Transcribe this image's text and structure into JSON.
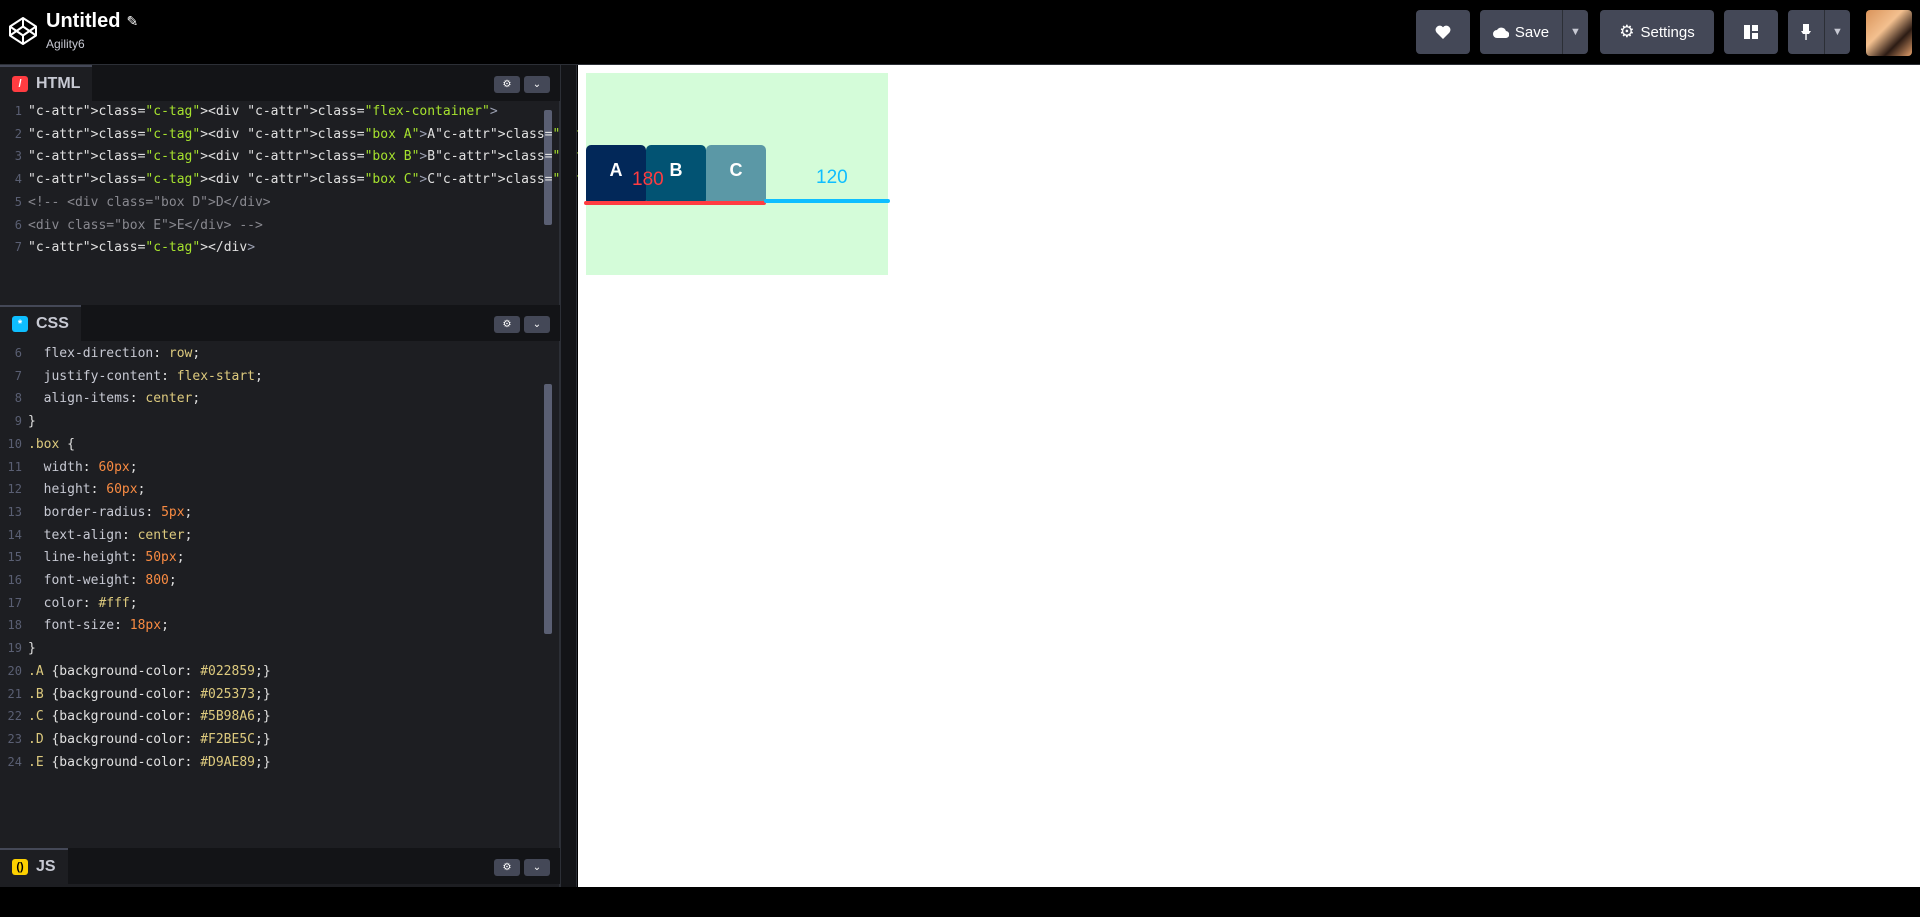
{
  "header": {
    "title": "Untitled",
    "subtitle": "Agility6",
    "save_label": "Save",
    "settings_label": "Settings"
  },
  "panels": {
    "html": {
      "label": "HTML",
      "icon": "/",
      "lines": [
        {
          "n": "1",
          "t": "<div class=\"flex-container\">"
        },
        {
          "n": "2",
          "t": "<div class=\"box A\">A</div>"
        },
        {
          "n": "3",
          "t": "<div class=\"box B\">B</div>"
        },
        {
          "n": "4",
          "t": "<div class=\"box C\">C</div>"
        },
        {
          "n": "5",
          "t": "<!-- <div class=\"box D\">D</div>"
        },
        {
          "n": "6",
          "t": "<div class=\"box E\">E</div> -->"
        },
        {
          "n": "7",
          "t": "</div>"
        }
      ]
    },
    "css": {
      "label": "CSS",
      "icon": "*",
      "lines": [
        {
          "n": "6",
          "t": "  flex-direction: row;"
        },
        {
          "n": "7",
          "t": "  justify-content: flex-start;"
        },
        {
          "n": "8",
          "t": "  align-items: center;"
        },
        {
          "n": "9",
          "t": "}"
        },
        {
          "n": "10",
          "t": ".box {"
        },
        {
          "n": "11",
          "t": "  width: 60px;"
        },
        {
          "n": "12",
          "t": "  height: 60px;"
        },
        {
          "n": "13",
          "t": "  border-radius: 5px;"
        },
        {
          "n": "14",
          "t": "  text-align: center;"
        },
        {
          "n": "15",
          "t": "  line-height: 50px;"
        },
        {
          "n": "16",
          "t": "  font-weight: 800;"
        },
        {
          "n": "17",
          "t": "  color: #fff;"
        },
        {
          "n": "18",
          "t": "  font-size: 18px;"
        },
        {
          "n": "19",
          "t": "}"
        },
        {
          "n": "20",
          "t": ".A {background-color: #022859;}"
        },
        {
          "n": "21",
          "t": ".B {background-color: #025373;}"
        },
        {
          "n": "22",
          "t": ".C {background-color: #5B98A6;}"
        },
        {
          "n": "23",
          "t": ".D {background-color: #F2BE5C;}"
        },
        {
          "n": "24",
          "t": ".E {background-color: #D9AE89;}"
        }
      ]
    },
    "js": {
      "label": "JS",
      "icon": "()"
    }
  },
  "preview": {
    "boxes": [
      {
        "label": "A",
        "color": "#022859"
      },
      {
        "label": "B",
        "color": "#025373"
      },
      {
        "label": "C",
        "color": "#5B98A6"
      }
    ],
    "label_red": "180",
    "label_blue": "120",
    "container_bg": "#d4fcd9"
  },
  "colors": {
    "accent_red": "#ff3c41",
    "accent_blue": "#0ebeff",
    "button_bg": "#444857"
  }
}
